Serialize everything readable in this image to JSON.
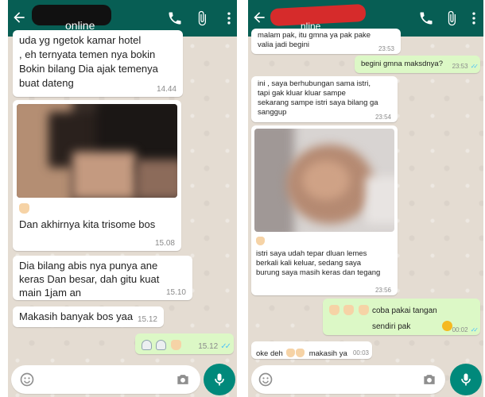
{
  "left": {
    "header": {
      "status": "online"
    },
    "messages": [
      {
        "id": "m1",
        "text": "uda yg ngetok kamar hotel\n, eh ternyata temen nya bokin\nBokin bilang Dia ajak temenya buat dateng",
        "time": "14.44"
      },
      {
        "id": "m2",
        "text": "Dan akhirnya kita trisome bos",
        "time": "15.08"
      },
      {
        "id": "m3",
        "text": "Dia bilang abis nya punya ane keras Dan besar, dah gitu kuat main 1jam an",
        "time": "15.10"
      },
      {
        "id": "m4",
        "text": "Makasih banyak bos yaa",
        "time": "15.12"
      },
      {
        "id": "m5",
        "text": "",
        "time": "15.12",
        "emoji": [
          "ghost",
          "ghost",
          "hand"
        ]
      }
    ]
  },
  "right": {
    "header": {
      "status": "nline"
    },
    "messages": [
      {
        "id": "r1",
        "text": "malam pak, itu gmna ya pak pake valia jadi begini",
        "time": "23:53"
      },
      {
        "id": "r2",
        "text": "begini gmna maksdnya?",
        "time": "23:53"
      },
      {
        "id": "r3",
        "text": "ini , saya berhubungan sama istri, tapi gak kluar kluar sampe sekarang sampe istri saya bilang ga sanggup",
        "time": "23:54"
      },
      {
        "id": "r4",
        "text": "istri saya udah tepar dluan lemes berkali kali keluar, sedang saya burung saya masih keras dan tegang",
        "time": "23:56"
      },
      {
        "id": "r5",
        "text": "coba pakai tangan\nsendiri pak",
        "time": "00:02"
      },
      {
        "id": "r6",
        "text": "oke deh",
        "text2": "makasih ya",
        "time": "00:03"
      }
    ]
  },
  "colors": {
    "header": "#075e54",
    "outgoing": "#dcf8c6",
    "incoming": "#ffffff",
    "mic": "#00897b",
    "ticks": "#4fc3f7"
  },
  "icons": [
    "arrow-back-icon",
    "phone-icon",
    "paperclip-icon",
    "more-vert-icon",
    "emoji-icon",
    "camera-icon",
    "mic-icon"
  ]
}
